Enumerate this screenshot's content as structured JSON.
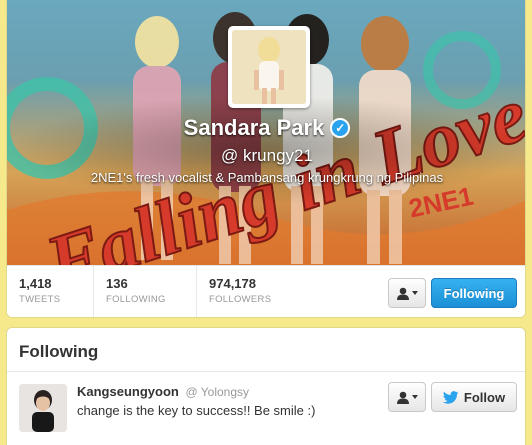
{
  "profile": {
    "display_name": "Sandara Park",
    "screen_name": "@ krungy21",
    "bio": "2NE1's fresh vocalist & Pambansang krungkrung ng Pilipinas",
    "verified": true,
    "banner_text": "Falling in Love",
    "banner_sub_text": "2NE1"
  },
  "stats": [
    {
      "value": "1,418",
      "label": "TWEETS"
    },
    {
      "value": "136",
      "label": "FOLLOWING"
    },
    {
      "value": "974,178",
      "label": "FOLLOWERS"
    }
  ],
  "actions": {
    "following_label": "Following"
  },
  "following_panel": {
    "title": "Following",
    "users": [
      {
        "name": "Kangseungyoon",
        "screen_name": "@ Yolongsy",
        "bio": "change is the key to success!! Be smile :)",
        "follow_label": "Follow"
      }
    ]
  },
  "colors": {
    "page_background": "#f6e98b",
    "accent_blue": "#1b8fd6",
    "verified_blue": "#2aa3ef",
    "banner_text_red": "#d63a2a"
  },
  "icons": {
    "verified": "verified-check-icon",
    "user_menu": "person-icon",
    "menu_caret": "caret-down-icon",
    "follow_bird": "twitter-bird-icon"
  }
}
